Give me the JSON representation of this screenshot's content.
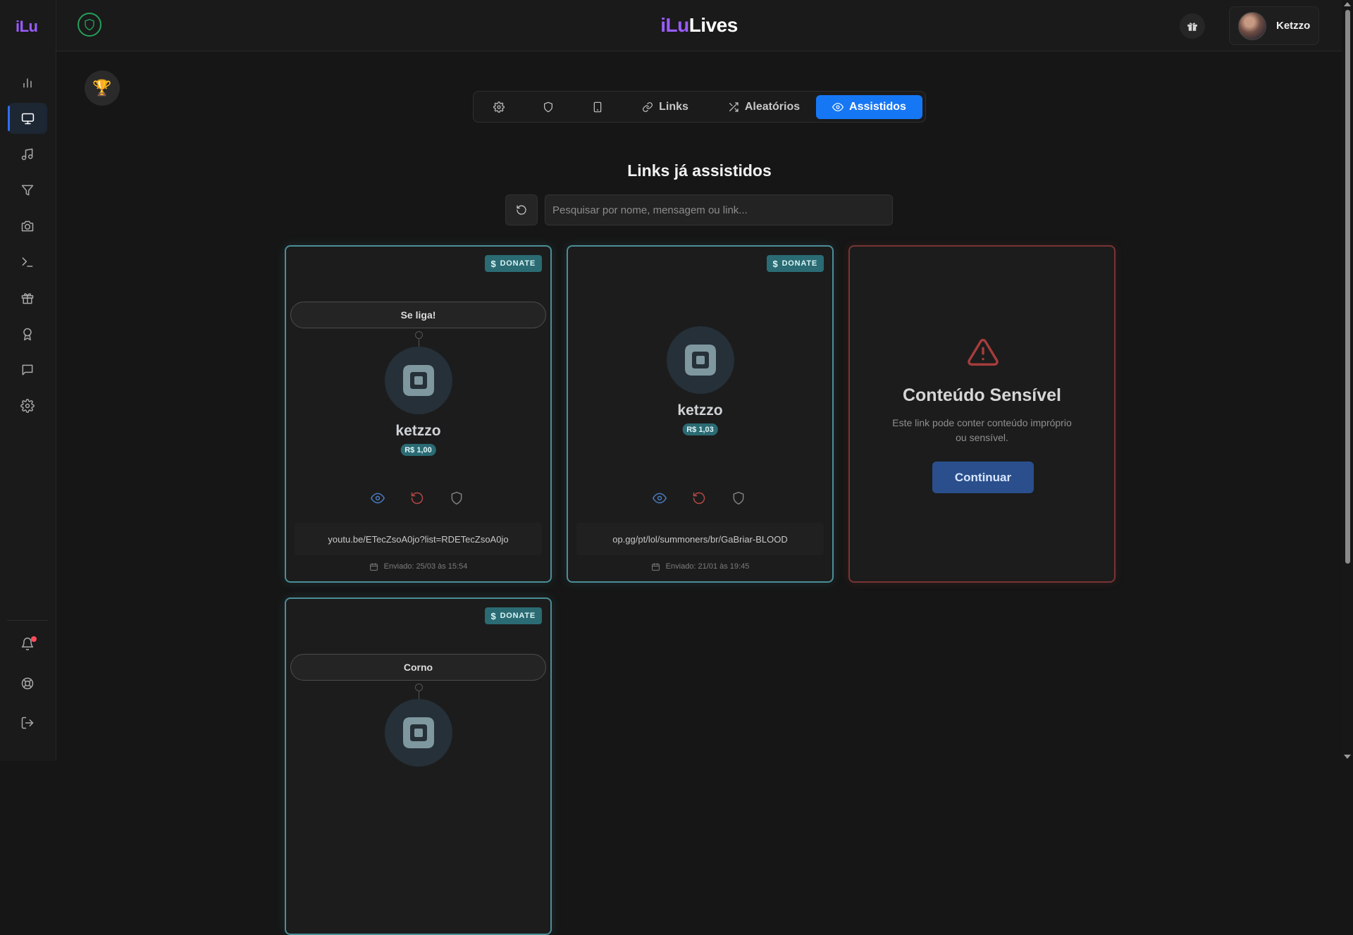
{
  "app": {
    "logo_text": "iLu",
    "brand_part1": "iLu",
    "brand_part2": "Lives",
    "accent_color": "#9a5cff",
    "primary_color": "#1677f5",
    "teal_color": "#2b6b73"
  },
  "sidebar": {
    "items": [
      {
        "icon": "bar-chart-icon",
        "active": false
      },
      {
        "icon": "monitor-icon",
        "active": true
      },
      {
        "icon": "music-note-icon",
        "active": false
      },
      {
        "icon": "filter-icon",
        "active": false
      },
      {
        "icon": "camera-icon",
        "active": false
      },
      {
        "icon": "terminal-icon",
        "active": false
      },
      {
        "icon": "gift-icon",
        "active": false
      },
      {
        "icon": "award-ribbon-icon",
        "active": false
      },
      {
        "icon": "chat-bubble-icon",
        "active": false
      },
      {
        "icon": "gear-icon",
        "active": false
      }
    ],
    "bottom_items": [
      {
        "icon": "bell-icon",
        "has_notification": true
      },
      {
        "icon": "lifebuoy-icon"
      },
      {
        "icon": "logout-icon"
      }
    ]
  },
  "header": {
    "user_name": "Ketzzo"
  },
  "tabs": [
    {
      "label": "",
      "icon": "gear-icon"
    },
    {
      "label": "",
      "icon": "shield-icon"
    },
    {
      "label": "",
      "icon": "tablet-icon"
    },
    {
      "label": "Links",
      "icon": "link-icon"
    },
    {
      "label": "Aleatórios",
      "icon": "shuffle-icon"
    },
    {
      "label": "Assistidos",
      "icon": "eye-icon",
      "active": true
    }
  ],
  "main": {
    "title": "Links já assistidos",
    "search_placeholder": "Pesquisar por nome, mensagem ou link..."
  },
  "cards": [
    {
      "badge": "DONATE",
      "message": "Se liga!",
      "donor": "ketzzo",
      "amount": "R$ 1,00",
      "url": "youtu.be/ETecZsoA0jo?list=RDETecZsoA0jo",
      "sent": "Enviado: 25/03 às 15:54"
    },
    {
      "badge": "DONATE",
      "donor": "ketzzo",
      "amount": "R$ 1,03",
      "url": "op.gg/pt/lol/summoners/br/GaBriar-BLOOD",
      "sent": "Enviado: 21/01 às 19:45"
    },
    {
      "sensitive": true,
      "title": "Conteúdo Sensível",
      "text": "Este link pode conter conteúdo impróprio ou sensível.",
      "button": "Continuar"
    },
    {
      "badge": "DONATE",
      "message": "Corno"
    }
  ]
}
